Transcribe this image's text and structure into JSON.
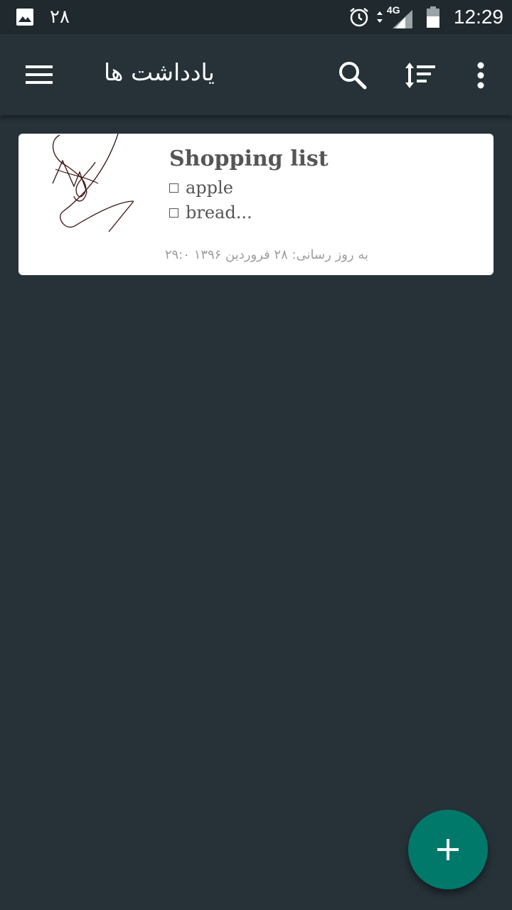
{
  "status_bar": {
    "notification_count": "۲۸",
    "network": "4G",
    "time": "12:29",
    "icons": [
      "image-notification-icon",
      "alarm-icon",
      "data-arrows-icon",
      "signal-icon",
      "battery-icon"
    ]
  },
  "app_bar": {
    "title": "یادداشت ها",
    "icons": [
      "menu-icon",
      "search-icon",
      "sort-icon",
      "more-vert-icon"
    ]
  },
  "notes": [
    {
      "title": "Shopping list",
      "items": [
        "apple",
        "bread..."
      ],
      "updated": "به روز رسانی: ۲۸ فروردین ۱۳۹۶ ۲۹:۰",
      "has_sketch": true
    }
  ],
  "fab": {
    "icon": "plus-icon",
    "color": "#00796b"
  },
  "colors": {
    "background": "#263238",
    "status_bar": "#1f292e",
    "card": "#ffffff",
    "text_dark": "#555555",
    "text_muted": "#9e9e9e"
  }
}
